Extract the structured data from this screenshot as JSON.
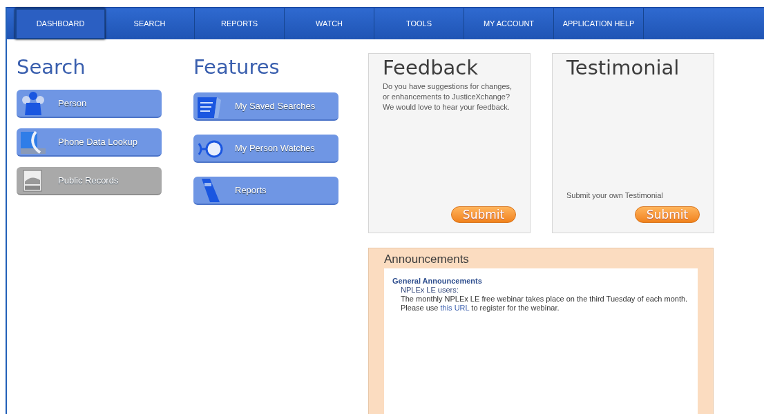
{
  "nav": [
    {
      "label": "DASHBOARD",
      "selected": true
    },
    {
      "label": "SEARCH",
      "selected": false
    },
    {
      "label": "REPORTS",
      "selected": false
    },
    {
      "label": "WATCH",
      "selected": false
    },
    {
      "label": "TOOLS",
      "selected": false
    },
    {
      "label": "MY ACCOUNT",
      "selected": false
    },
    {
      "label": "APPLICATION HELP",
      "selected": false
    }
  ],
  "search": {
    "title": "Search",
    "items": [
      {
        "label": "Person",
        "kind": "person",
        "disabled": false
      },
      {
        "label": "Phone Data Lookup",
        "kind": "phone",
        "disabled": false
      },
      {
        "label": "Public Records",
        "kind": "records",
        "disabled": true
      }
    ]
  },
  "features": {
    "title": "Features",
    "items": [
      {
        "label": "My Saved Searches",
        "kind": "saved",
        "disabled": false
      },
      {
        "label": "My Person Watches",
        "kind": "watch",
        "disabled": false
      },
      {
        "label": "Reports",
        "kind": "report",
        "disabled": false
      }
    ]
  },
  "feedback": {
    "title": "Feedback",
    "text": "Do you have suggestions for changes, or enhancements to JusticeXchange? We would love to hear your feedback.",
    "button": "Submit"
  },
  "testimonial": {
    "title": "Testimonial",
    "text": "Submit your own Testimonial",
    "button": "Submit"
  },
  "announcements": {
    "title": "Announcements",
    "heading": "General Announcements",
    "greeting": "NPLEx LE users:",
    "message_before": "The monthly NPLEx LE free webinar takes place on the third Tuesday of each month. Please use ",
    "link": "this URL",
    "message_after": " to register for the webinar."
  }
}
